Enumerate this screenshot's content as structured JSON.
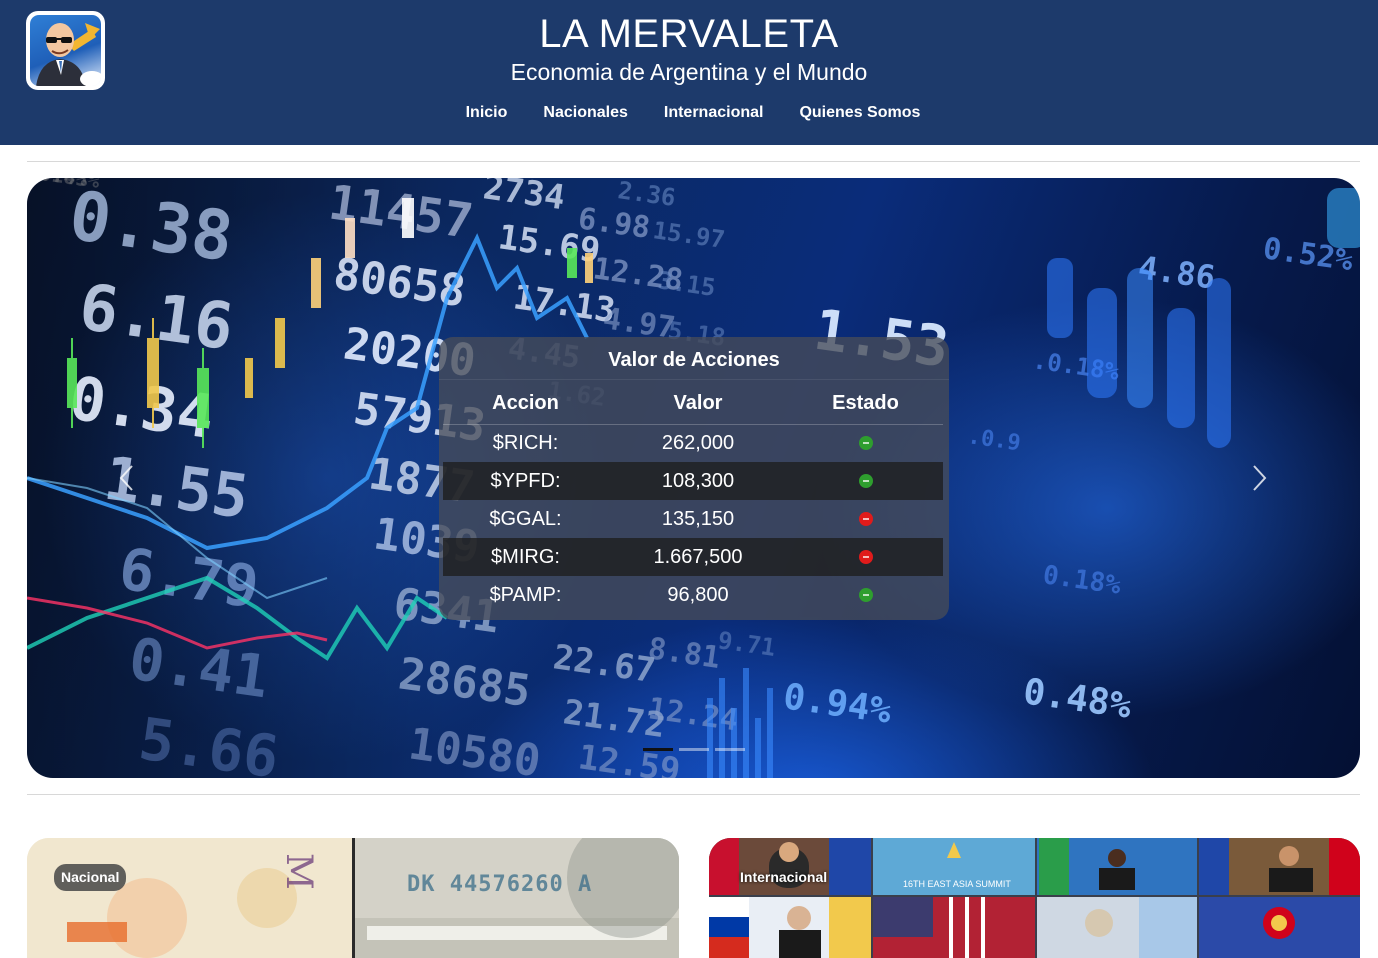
{
  "header": {
    "title": "LA MERVALETA",
    "subtitle": "Economia de Argentina y el Mundo",
    "nav": [
      {
        "label": "Inicio"
      },
      {
        "label": "Nacionales"
      },
      {
        "label": "Internacional"
      },
      {
        "label": "Quienes Somos"
      }
    ]
  },
  "carousel": {
    "prev_icon": "chevron-left-icon",
    "next_icon": "chevron-right-icon",
    "slide_count": 3,
    "active_slide": 1,
    "background_figures": [
      "0.38",
      "6.16",
      "0.34",
      "1.55",
      "6.79",
      "0.41",
      "5.66",
      "11457",
      "80658",
      "20200",
      "57913",
      "1877",
      "1039",
      "6341",
      "28685",
      "10580",
      "2734",
      "15.69",
      "17.13",
      "4.45",
      "22.67",
      "21.72",
      "12.59",
      "6.98",
      "12.28",
      "4.97",
      "8.81",
      "12.24",
      "15.97",
      "3.15",
      "5.18",
      "1.62",
      "9.71",
      "2.36",
      "1.53",
      "4.86",
      "0.52%",
      ".0.18%",
      ".0.9",
      "0.18%",
      "0.94%",
      "0.48%",
      "0.18%",
      ".0.45%"
    ]
  },
  "stocks": {
    "title": "Valor de Acciones",
    "columns": {
      "accion": "Accion",
      "valor": "Valor",
      "estado": "Estado"
    },
    "rows": [
      {
        "accion": "$RICH:",
        "valor": "262,000",
        "estado": "up",
        "color": "#2e9e2e"
      },
      {
        "accion": "$YPFD:",
        "valor": "108,300",
        "estado": "up",
        "color": "#2e9e2e"
      },
      {
        "accion": "$GGAL:",
        "valor": "135,150",
        "estado": "down",
        "color": "#e01b1b"
      },
      {
        "accion": "$MIRG:",
        "valor": "1.667,500",
        "estado": "down",
        "color": "#e01b1b"
      },
      {
        "accion": "$PAMP:",
        "valor": "96,800",
        "estado": "up",
        "color": "#2e9e2e"
      }
    ]
  },
  "cards": [
    {
      "badge": "Nacional",
      "image_text": "DK 44576260 A"
    },
    {
      "badge": "Internacional",
      "image_text": "16TH EAST ASIA SUMMIT"
    }
  ],
  "colors": {
    "header_bg": "#1d3a6b",
    "up": "#2e9e2e",
    "down": "#e01b1b"
  }
}
